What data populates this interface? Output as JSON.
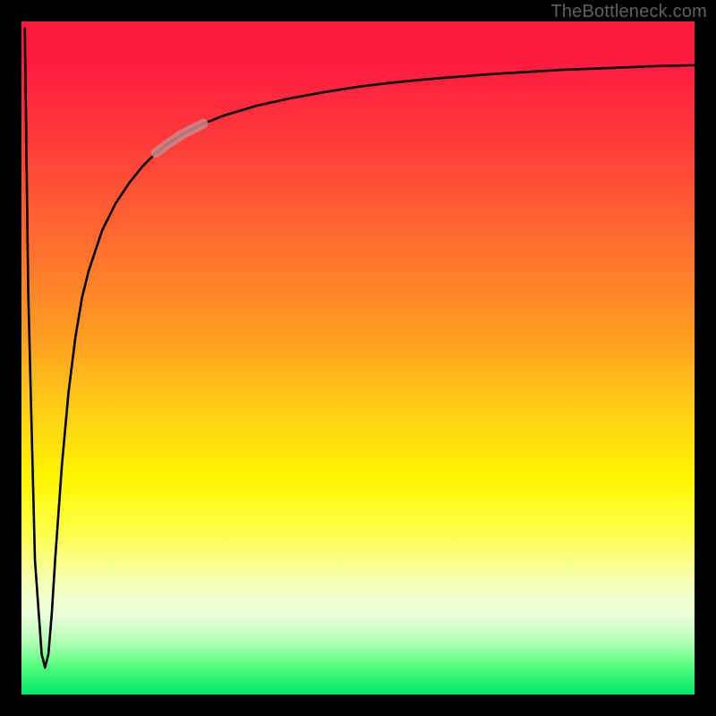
{
  "attribution": "TheBottleneck.com",
  "colors": {
    "frame": "#000000",
    "gradient_top": "#ff1a40",
    "gradient_mid": "#fff500",
    "gradient_bottom": "#00e66b",
    "curve": "#000000",
    "highlight": "#c88a88"
  },
  "chart_data": {
    "type": "line",
    "title": "",
    "xlabel": "",
    "ylabel": "",
    "xlim": [
      0,
      100
    ],
    "ylim": [
      0,
      100
    ],
    "x": [
      0.5,
      1,
      2,
      3,
      3.5,
      4,
      4.5,
      5,
      6,
      7,
      8,
      9,
      10,
      12,
      14,
      16,
      18,
      20,
      22,
      24,
      27,
      30,
      35,
      40,
      45,
      50,
      55,
      60,
      65,
      70,
      75,
      80,
      85,
      90,
      95,
      100
    ],
    "values": [
      99,
      60,
      20,
      6,
      4,
      6,
      12,
      20,
      34,
      45,
      53,
      59,
      63,
      69,
      73,
      76,
      78.5,
      80.5,
      82,
      83.3,
      84.8,
      86,
      87.5,
      88.6,
      89.5,
      90.3,
      90.9,
      91.4,
      91.8,
      92.2,
      92.5,
      92.8,
      93,
      93.2,
      93.4,
      93.5
    ],
    "highlight_segment": {
      "x_start": 20,
      "x_end": 27,
      "y_start": 80.5,
      "y_end": 84.8
    },
    "note": "Axis values are inferred from pixel positions; no numeric tick labels are present in the image."
  }
}
